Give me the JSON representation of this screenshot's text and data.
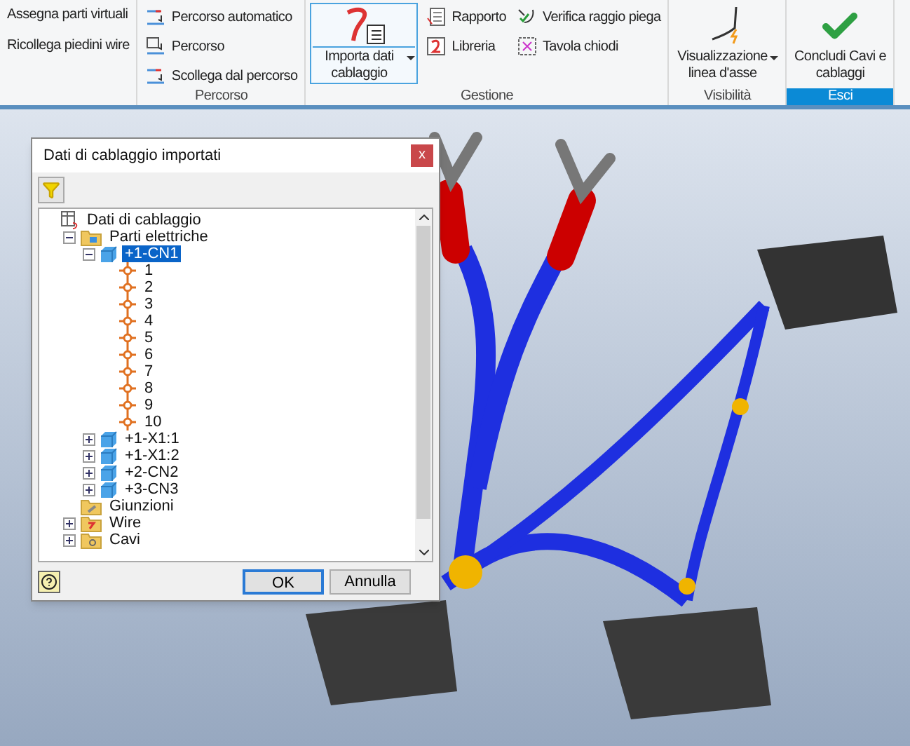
{
  "ribbon": {
    "groups": [
      {
        "items": [
          {
            "kind": "text",
            "label": "Assegna parti virtuali"
          },
          {
            "kind": "text",
            "label": "Ricollega piedini wire"
          }
        ]
      },
      {
        "label": "Percorso",
        "highlight": false,
        "items": [
          {
            "kind": "small",
            "label": "Percorso automatico"
          },
          {
            "kind": "small",
            "label": "Percorso"
          },
          {
            "kind": "small",
            "label": "Scollega dal percorso"
          }
        ]
      },
      {
        "label": "Gestione",
        "highlight": false,
        "items": [
          {
            "kind": "large",
            "label": "Importa dati cablaggio",
            "dropdown": true,
            "selected": true
          },
          {
            "kind": "small",
            "label": "Rapporto"
          },
          {
            "kind": "small",
            "label": "Libreria"
          },
          {
            "kind": "small",
            "label": "Verifica raggio piega"
          },
          {
            "kind": "small",
            "label": "Tavola chiodi"
          }
        ]
      },
      {
        "label": "Visibilità",
        "highlight": false,
        "items": [
          {
            "kind": "large",
            "label": "Visualizzazione linea d'asse",
            "dropdown": true,
            "selected": false
          }
        ]
      },
      {
        "label": "Esci",
        "highlight": true,
        "items": [
          {
            "kind": "large",
            "label": "Concludi Cavi e cablaggi",
            "dropdown": false,
            "selected": false
          }
        ]
      }
    ]
  },
  "dialog": {
    "title": "Dati di cablaggio importati",
    "close": "x",
    "tree": [
      {
        "label": "Dati di cablaggio",
        "kind": "root",
        "selected": false,
        "children": [
          {
            "label": "Parti elettriche",
            "kind": "folder",
            "expanded": true,
            "selected": false,
            "children": [
              {
                "label": "+1-CN1",
                "kind": "connector",
                "expanded": true,
                "selected": true,
                "children": [
                  {
                    "label": "1",
                    "kind": "pin",
                    "selected": false
                  },
                  {
                    "label": "2",
                    "kind": "pin",
                    "selected": false
                  },
                  {
                    "label": "3",
                    "kind": "pin",
                    "selected": false
                  },
                  {
                    "label": "4",
                    "kind": "pin",
                    "selected": false
                  },
                  {
                    "label": "5",
                    "kind": "pin",
                    "selected": false
                  },
                  {
                    "label": "6",
                    "kind": "pin",
                    "selected": false
                  },
                  {
                    "label": "7",
                    "kind": "pin",
                    "selected": false
                  },
                  {
                    "label": "8",
                    "kind": "pin",
                    "selected": false
                  },
                  {
                    "label": "9",
                    "kind": "pin",
                    "selected": false
                  },
                  {
                    "label": "10",
                    "kind": "pin",
                    "selected": false
                  }
                ]
              },
              {
                "label": "+1-X1:1",
                "kind": "connector",
                "expanded": false,
                "selected": false
              },
              {
                "label": "+1-X1:2",
                "kind": "connector",
                "expanded": false,
                "selected": false
              },
              {
                "label": "+2-CN2",
                "kind": "connector",
                "expanded": false,
                "selected": false
              },
              {
                "label": "+3-CN3",
                "kind": "connector",
                "expanded": false,
                "selected": false
              }
            ]
          },
          {
            "label": "Giunzioni",
            "kind": "splice-folder",
            "selected": false
          },
          {
            "label": "Wire",
            "kind": "wire-folder",
            "expanded": false,
            "selected": false
          },
          {
            "label": "Cavi",
            "kind": "cable-folder",
            "expanded": false,
            "selected": false
          }
        ]
      }
    ],
    "buttons": [
      {
        "label": "OK",
        "default": true
      },
      {
        "label": "Annulla",
        "default": false
      }
    ]
  }
}
